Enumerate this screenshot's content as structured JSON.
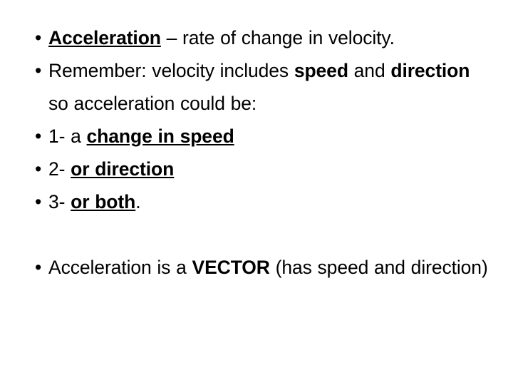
{
  "slide": {
    "background_color": "#ffffff",
    "text_color": "#000000",
    "bullet_glyph": "•"
  },
  "blocks": [
    {
      "name": "definition-block",
      "items": [
        {
          "name": "bullet-acceleration-definition",
          "plain_text": "Acceleration – rate of change in velocity.",
          "runs": [
            {
              "text": "Acceleration",
              "style": "bold-underline"
            },
            {
              "text": " – rate of change in velocity.",
              "style": "plain"
            }
          ]
        },
        {
          "name": "bullet-remember-velocity",
          "plain_text": "Remember: velocity includes speed and direction so acceleration could be:",
          "runs": [
            {
              "text": "Remember: velocity includes ",
              "style": "plain"
            },
            {
              "text": "speed",
              "style": "bold"
            },
            {
              "text": " and ",
              "style": "plain"
            },
            {
              "text": "direction",
              "style": "bold"
            },
            {
              "text": " so acceleration could be:",
              "style": "plain"
            }
          ]
        },
        {
          "name": "bullet-item-1-change-in-speed",
          "plain_text": "1- a change in speed",
          "runs": [
            {
              "text": "1- a ",
              "style": "plain"
            },
            {
              "text": "change in speed",
              "style": "bold-underline"
            }
          ]
        },
        {
          "name": "bullet-item-2-or-direction",
          "plain_text": "2- or direction",
          "runs": [
            {
              "text": "2- ",
              "style": "plain"
            },
            {
              "text": "or direction",
              "style": "bold-underline"
            }
          ]
        },
        {
          "name": "bullet-item-3-or-both",
          "plain_text": "3- or both.",
          "runs": [
            {
              "text": "3- ",
              "style": "plain"
            },
            {
              "text": "or both",
              "style": "bold-underline"
            },
            {
              "text": ".",
              "style": "plain"
            }
          ]
        }
      ]
    },
    {
      "name": "vector-block",
      "items": [
        {
          "name": "bullet-acceleration-is-vector",
          "plain_text": "Acceleration is a VECTOR (has speed and direction)",
          "runs": [
            {
              "text": "Acceleration is a ",
              "style": "plain"
            },
            {
              "text": "VECTOR",
              "style": "bold"
            },
            {
              "text": " (has speed and direction)",
              "style": "plain"
            }
          ]
        }
      ]
    }
  ]
}
